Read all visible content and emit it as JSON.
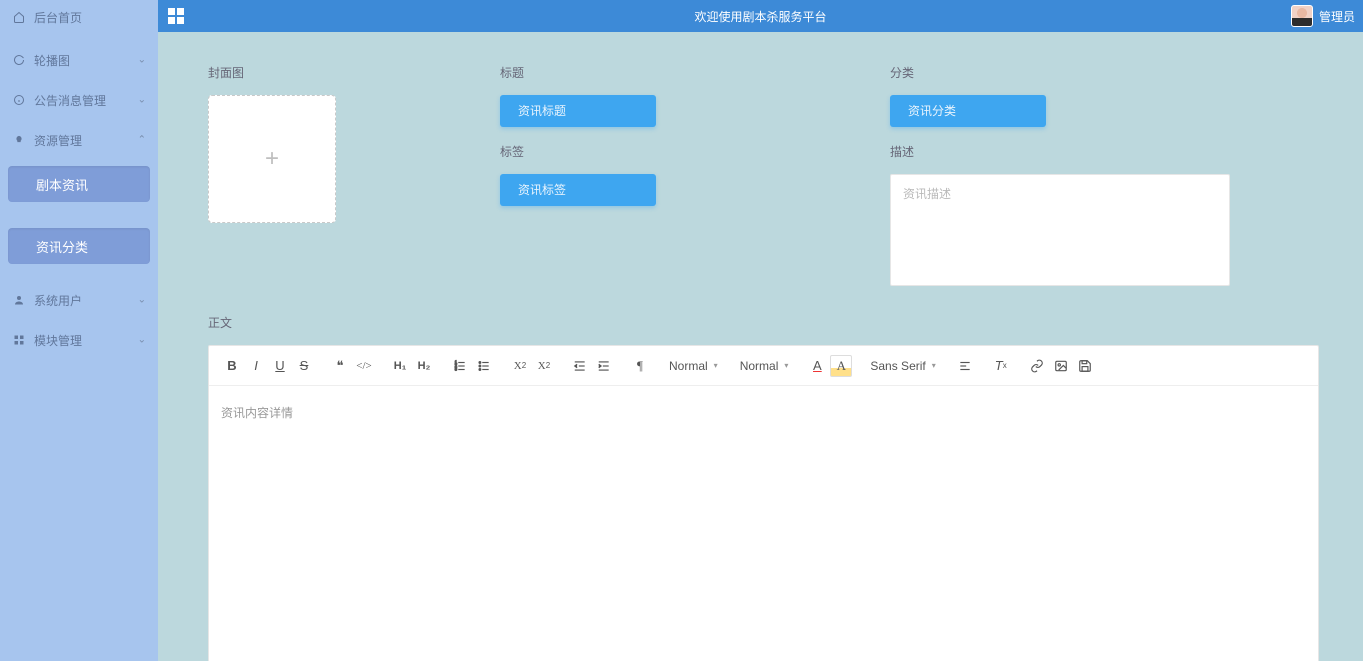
{
  "topbar": {
    "title": "欢迎使用剧本杀服务平台",
    "user_role": "管理员"
  },
  "sidebar": {
    "home": "后台首页",
    "items": [
      {
        "label": "轮播图",
        "icon": "refresh"
      },
      {
        "label": "公告消息管理",
        "icon": "info"
      },
      {
        "label": "资源管理",
        "icon": "bulb",
        "expanded": true
      },
      {
        "label": "系统用户",
        "icon": "user"
      },
      {
        "label": "模块管理",
        "icon": "grid"
      }
    ],
    "subs": [
      {
        "label": "剧本资讯"
      },
      {
        "label": "资讯分类"
      }
    ]
  },
  "form": {
    "cover_label": "封面图",
    "title_label": "标题",
    "title_placeholder": "资讯标题",
    "tag_label": "标签",
    "tag_placeholder": "资讯标签",
    "category_label": "分类",
    "category_placeholder": "资讯分类",
    "desc_label": "描述",
    "desc_placeholder": "资讯描述",
    "body_label": "正文",
    "body_placeholder": "资讯内容详情"
  },
  "editor": {
    "size_select": "Normal",
    "header_select": "Normal",
    "font_select": "Sans Serif"
  }
}
